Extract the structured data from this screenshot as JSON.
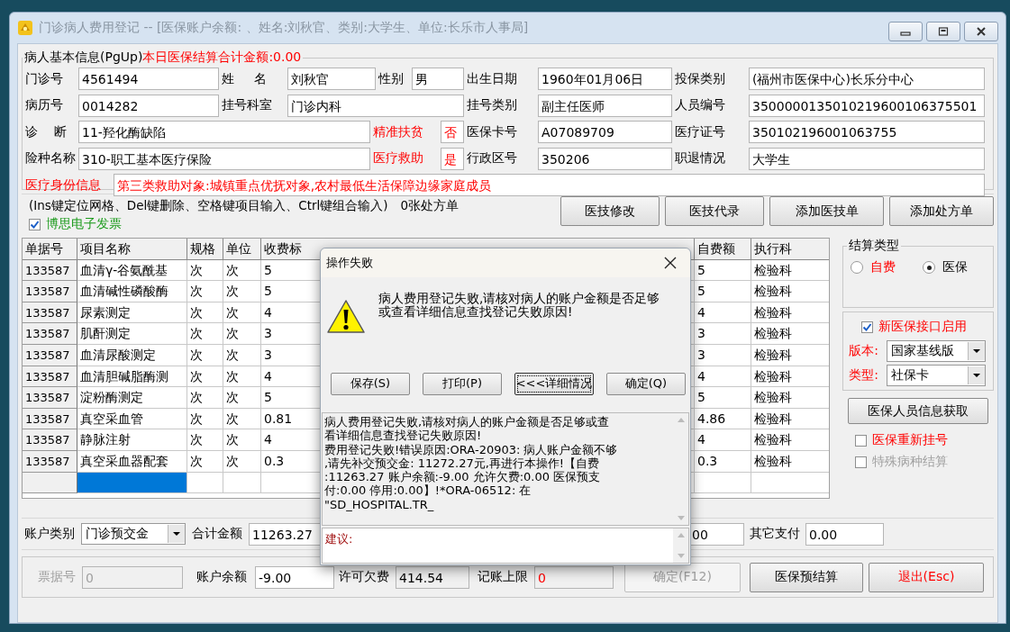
{
  "window": {
    "title": "门诊病人费用登记 -- [医保账户余额: 、姓名:刘秋官、类别:大学生、单位:长乐市人事局]"
  },
  "patient_info": {
    "legend": "病人基本信息(PgUp)",
    "today_total": "本日医保结算合计金额:0.00",
    "fields": [
      {
        "label": "门诊号",
        "label_highlight": false,
        "value": "4561494",
        "value_highlight": false
      },
      {
        "label": "姓     名",
        "label_highlight": false,
        "value": "刘秋官",
        "value_highlight": false
      },
      {
        "label": "性别",
        "label_highlight": false,
        "value": "男",
        "value_highlight": false
      },
      {
        "label": "出生日期",
        "label_highlight": false,
        "value": "1960年01月06日",
        "value_highlight": false
      },
      {
        "label": "投保类别",
        "label_highlight": false,
        "value": "(福州市医保中心)长乐分中心",
        "value_highlight": false
      },
      {
        "label": "病历号",
        "label_highlight": false,
        "value": "0014282",
        "value_highlight": false
      },
      {
        "label": "挂号科室",
        "label_highlight": false,
        "value": "门诊内科",
        "value_highlight": false
      },
      {
        "label": "挂号类别",
        "label_highlight": false,
        "value": "副主任医师",
        "value_highlight": false
      },
      {
        "label": "人员编号",
        "label_highlight": false,
        "value": "3500000135010219600106375501",
        "value_highlight": false
      },
      {
        "label": "诊    断",
        "label_highlight": false,
        "value": "11-羟化酶缺陷",
        "value_highlight": false
      },
      {
        "label": "精准扶贫",
        "label_highlight": true,
        "value": "否",
        "value_highlight": true
      },
      {
        "label": "医保卡号",
        "label_highlight": false,
        "value": "A07089709",
        "value_highlight": false
      },
      {
        "label": "医疗证号",
        "label_highlight": false,
        "value": "350102196001063755",
        "value_highlight": false
      },
      {
        "label": "险种名称",
        "label_highlight": false,
        "value": "310-职工基本医疗保险",
        "value_highlight": false
      },
      {
        "label": "医疗救助",
        "label_highlight": true,
        "value": "是",
        "value_highlight": true
      },
      {
        "label": "行政区号",
        "label_highlight": false,
        "value": "350206",
        "value_highlight": false
      },
      {
        "label": "职退情况",
        "label_highlight": false,
        "value": "大学生",
        "value_highlight": false
      },
      {
        "label": "医疗身份信息",
        "label_highlight": true,
        "value": "第三类救助对象:城镇重点优抚对象,农村最低生活保障边缘家庭成员",
        "value_highlight": true
      }
    ]
  },
  "actions": {
    "hint": "(Ins键定位网格、Del键删除、空格键项目输入、Ctrl键组合输入)",
    "prescription_count": "0张处方单",
    "e_invoice": {
      "label": "博思电子发票",
      "checked": true
    },
    "buttons": [
      "医技修改",
      "医技代录",
      "添加医技单",
      "添加处方单"
    ]
  },
  "table": {
    "columns": [
      "单据号",
      "项目名称",
      "规格",
      "单位",
      "收费标",
      "自费额",
      "执行科"
    ],
    "rows": [
      [
        "133587",
        "血清γ-谷氨酰基",
        "次",
        "次",
        "5",
        "5",
        "检验科"
      ],
      [
        "133587",
        "血清碱性磷酸酶",
        "次",
        "次",
        "5",
        "5",
        "检验科"
      ],
      [
        "133587",
        "尿素测定",
        "次",
        "次",
        "4",
        "4",
        "检验科"
      ],
      [
        "133587",
        "肌酐测定",
        "次",
        "次",
        "3",
        "3",
        "检验科"
      ],
      [
        "133587",
        "血清尿酸测定",
        "次",
        "次",
        "3",
        "3",
        "检验科"
      ],
      [
        "133587",
        "血清胆碱脂酶测",
        "次",
        "次",
        "4",
        "4",
        "检验科"
      ],
      [
        "133587",
        "淀粉酶测定",
        "次",
        "次",
        "5",
        "5",
        "检验科"
      ],
      [
        "133587",
        "真空采血管",
        "次",
        "次",
        "0.81",
        "4.86",
        "检验科"
      ],
      [
        "133587",
        "静脉注射",
        "次",
        "次",
        "4",
        "4",
        "检验科"
      ],
      [
        "133587",
        "真空采血器配套",
        "次",
        "次",
        "0.3",
        "0.3",
        "检验科"
      ]
    ],
    "blank_row": {
      "selected": true
    }
  },
  "settlement": {
    "title": "结算类型",
    "options": [
      {
        "label": "自费",
        "selected": false,
        "highlight": true
      },
      {
        "label": "医保",
        "selected": true,
        "highlight": false
      }
    ]
  },
  "insurance": {
    "new_interface": {
      "label": "新医保接口启用",
      "checked": true
    },
    "selects": [
      {
        "label": "版本:",
        "value": "国家基线版"
      },
      {
        "label": "类型:",
        "value": "社保卡"
      }
    ],
    "fetch_button": "医保人员信息获取",
    "checks": [
      {
        "label": "医保重新挂号",
        "checked": false,
        "disabled": false
      },
      {
        "label": "特殊病种结算",
        "checked": false,
        "disabled": true
      }
    ]
  },
  "account": [
    {
      "label": "账户类别",
      "value": "门诊预交金",
      "kind": "combo"
    },
    {
      "label": "合计金额",
      "value": "11263.27",
      "kind": "text"
    },
    {
      "value": "00",
      "kind": "text"
    },
    {
      "label": "其它支付",
      "value": "0.00",
      "kind": "text"
    }
  ],
  "bottom": {
    "fields": [
      {
        "label": "票据号",
        "value": "0",
        "disabled": true,
        "readonly": true,
        "highlight": false
      },
      {
        "label": "账户余额",
        "value": "-9.00",
        "disabled": false,
        "readonly": false,
        "highlight": false
      },
      {
        "label": "许可欠费",
        "value": "414.54",
        "disabled": false,
        "readonly": true,
        "highlight": false
      },
      {
        "label": "记账上限",
        "value": "0",
        "disabled": false,
        "readonly": true,
        "highlight": true
      }
    ],
    "buttons": [
      {
        "label": "确定(F12)",
        "disabled": true,
        "highlight": false
      },
      {
        "label": "医保预结算",
        "disabled": false,
        "highlight": false
      },
      {
        "label": "退出(Esc)",
        "disabled": false,
        "highlight": true
      }
    ]
  },
  "dialog": {
    "title": "操作失败",
    "message": [
      "病人费用登记失败,请核对病人的账户金额是否足够",
      "或查看详细信息查找登记失败原因!"
    ],
    "buttons": [
      {
        "label": "保存(S)",
        "focused": false
      },
      {
        "label": "打印(P)",
        "focused": false
      },
      {
        "label": "<<<详细情况",
        "focused": true
      },
      {
        "label": "确定(Q)",
        "focused": false
      }
    ],
    "details": [
      "病人费用登记失败,请核对病人的账户金额是否足够或查",
      "看详细信息查找登记失败原因!",
      "费用登记失败!错误原因:ORA-20903: 病人账户金额不够",
      ",请先补交预交金:  11272.27元,再进行本操作!【自费",
      ":11263.27 账户余额:-9.00 允许欠费:0.00 医保预支",
      "付:0.00 停用:0.00】!*ORA-06512: 在",
      "\"SD_HOSPITAL.TR_"
    ],
    "advice": "建议:"
  }
}
